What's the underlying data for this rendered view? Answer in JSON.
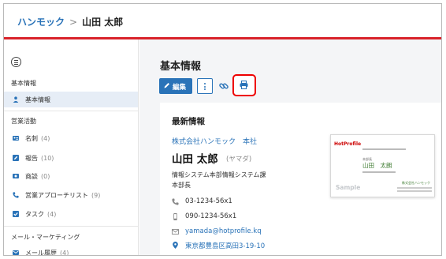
{
  "breadcrumb": {
    "home": "ハンモック",
    "separator": ">",
    "current": "山田 太郎"
  },
  "sidebar": {
    "menu_icon": "hamburger-circle-icon",
    "sections": [
      {
        "title": "基本情報",
        "items": [
          {
            "label": "基本情報",
            "count": "",
            "icon": "person-icon",
            "active": true
          }
        ]
      },
      {
        "title": "営業活動",
        "items": [
          {
            "label": "名刺",
            "count": "(4)",
            "icon": "business-card-icon",
            "active": false
          },
          {
            "label": "報告",
            "count": "(10)",
            "icon": "pencil-square-icon",
            "active": false
          },
          {
            "label": "商談",
            "count": "(0)",
            "icon": "deal-icon",
            "active": false
          },
          {
            "label": "営業アプローチリスト",
            "count": "(9)",
            "icon": "phone-icon",
            "active": false
          },
          {
            "label": "タスク",
            "count": "(4)",
            "icon": "checkbox-icon",
            "active": false
          }
        ]
      },
      {
        "title": "メール・マーケティング",
        "items": [
          {
            "label": "メール履歴",
            "count": "(4)",
            "icon": "mail-icon",
            "active": false
          }
        ]
      }
    ]
  },
  "main": {
    "title": "基本情報",
    "toolbar": {
      "edit_label": "編集",
      "edit_icon": "pencil-icon",
      "more_icon": "vertical-dots-icon",
      "link_icon": "link-icon",
      "print_icon": "printer-icon"
    },
    "card": {
      "title": "最新情報",
      "company": "株式会社ハンモック　本社",
      "name": "山田 太郎",
      "kana": "(ヤマダ)",
      "department": "情報システム本部情報システム課",
      "role": "本部長",
      "contacts": [
        {
          "type": "phone",
          "icon": "phone-icon",
          "value": "03-1234-56x1",
          "link": false
        },
        {
          "type": "mobile",
          "icon": "mobile-icon",
          "value": "090-1234-56x1",
          "link": false
        },
        {
          "type": "email",
          "icon": "envelope-icon",
          "value": "yamada@hotprofile.kq",
          "link": true
        },
        {
          "type": "address",
          "icon": "map-pin-icon",
          "value": "東京都豊島区高田3-19-10",
          "link": true
        }
      ]
    },
    "business_card": {
      "logo_text": "HotProfile",
      "dept": "本部長",
      "name": "山田　太朗",
      "company": "株式会社ハンモック",
      "watermark": "Sample"
    }
  },
  "colors": {
    "accent": "#2a73b8",
    "header_rule": "#d9222a",
    "highlight": "#ee0000",
    "active_bg": "#e6edf6"
  }
}
